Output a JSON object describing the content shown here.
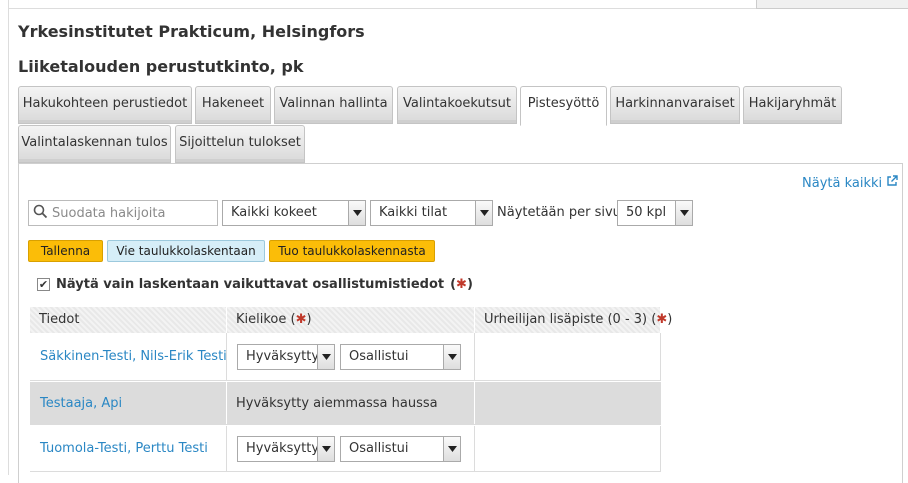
{
  "header": {
    "organization": "Yrkesinstitutet Prakticum, Helsingfors",
    "program": "Liiketalouden perustutkinto, pk"
  },
  "tabs": [
    {
      "label": "Hakukohteen perustiedot",
      "active": false
    },
    {
      "label": "Hakeneet",
      "active": false
    },
    {
      "label": "Valinnan hallinta",
      "active": false
    },
    {
      "label": "Valintakoekutsut",
      "active": false
    },
    {
      "label": "Pistesyöttö",
      "active": true
    },
    {
      "label": "Harkinnanvaraiset",
      "active": false
    },
    {
      "label": "Hakijaryhmät",
      "active": false
    },
    {
      "label": "Valintalaskennan tulos",
      "active": false
    },
    {
      "label": "Sijoittelun tulokset",
      "active": false
    }
  ],
  "toolbar": {
    "show_all": "Näytä kaikki",
    "search_placeholder": "Suodata hakijoita",
    "exam_filter": "Kaikki kokeet",
    "status_filter": "Kaikki tilat",
    "per_page_label": "Näytetään per sivu:",
    "per_page_value": "50 kpl",
    "save": "Tallenna",
    "export": "Vie taulukkolaskentaan",
    "import": "Tuo taulukkolaskennasta"
  },
  "filter_checkbox": {
    "label": "Näytä vain laskentaan vaikuttavat osallistumistiedot",
    "checked": true,
    "required_mark": "✱"
  },
  "table": {
    "columns": [
      {
        "label": "Tiedot",
        "required": false
      },
      {
        "label": "Kielikoe",
        "required": true
      },
      {
        "label": "Urheilijan lisäpiste (0 - 3)",
        "required": true
      }
    ],
    "rows": [
      {
        "name": "Säkkinen-Testi, Nils-Erik Testi",
        "result": "Hyväksytty",
        "participation": "Osallistui",
        "note": ""
      },
      {
        "name": "Testaaja, Api",
        "result": "",
        "participation": "",
        "note": "Hyväksytty aiemmassa haussa"
      },
      {
        "name": "Tuomola-Testi, Perttu Testi",
        "result": "Hyväksytty",
        "participation": "Osallistui",
        "note": ""
      }
    ]
  },
  "colors": {
    "link": "#2a87c4",
    "accent_yellow": "#fbbd08",
    "accent_blue": "#d6eef8",
    "required": "#c0392b"
  }
}
